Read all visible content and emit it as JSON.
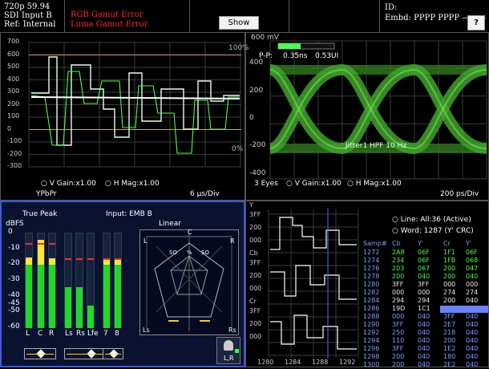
{
  "header": {
    "format": "720p 59.94",
    "input": "SDI Input B",
    "ref": "Ref: Internal",
    "errors": [
      "RGB Gamut Error",
      "Luma Gamut Error"
    ],
    "show_menu": "Show Menu",
    "id_label": "ID:",
    "embd": "Embd: PPPP PPPP ———",
    "help": "?"
  },
  "waveform": {
    "y_ticks": [
      "700",
      "600",
      "500",
      "400",
      "300",
      "200",
      "100",
      "0",
      "-100",
      "-200",
      "-300"
    ],
    "pct_top": "100%",
    "pct_bottom": "0%",
    "v_gain": "V Gain:x1.00",
    "h_mag": "H Mag:x1.00",
    "mode": "YPbPr",
    "timebase": "6 µs/Div"
  },
  "eye": {
    "mv_top": "600 mV",
    "pp_label": "P-P:",
    "pp_time": "0.35ns",
    "pp_ui": "0.53UI",
    "y_ticks": [
      "400",
      "200",
      "0",
      "-200",
      "-400"
    ],
    "jitter": "Jitter1 HPF 10 Hz",
    "eyes": "3 Eyes",
    "v_gain": "V Gain:x1.00",
    "h_mag": "H Mag:x1.00",
    "timebase": "200 ps/Div"
  },
  "audio": {
    "true_peak": "True Peak",
    "input": "Input: EMB B",
    "unit": "dBFS",
    "scale": [
      "0",
      "-10",
      "-20",
      "-30",
      "-40",
      "-45",
      "-50",
      "-60"
    ],
    "channels": [
      "L",
      "C",
      "R",
      "Ls",
      "Rs",
      "Lfe",
      "7",
      "8"
    ],
    "levels_db": [
      -15,
      -4,
      -16,
      -34,
      -34,
      -46,
      -17,
      -17
    ],
    "peak_db": [
      -6,
      -6,
      -6,
      -16,
      -16,
      -16,
      -16,
      -16
    ],
    "surround": {
      "title": "Linear",
      "c": "C",
      "l": "L",
      "r": "R",
      "ls": "Ls",
      "rs": "Rs",
      "so_l": "SO",
      "so_c": "%",
      "so_r": "SO",
      "lr": "L,R"
    }
  },
  "data_view": {
    "axis_labels": [
      "Y",
      "3FF",
      "200",
      "000",
      "Cb",
      "3FF",
      "200",
      "000",
      "Cr",
      "3FF",
      "200",
      "000"
    ],
    "x_ticks": [
      "1280",
      "1284",
      "1288",
      "1292"
    ],
    "line": "Line: All:36 (Active)",
    "word": "Word: 1287 (Y' CRC)",
    "columns": [
      "Samp#",
      "Cb",
      "Y'",
      "Cr",
      "Y'"
    ],
    "rows": [
      [
        "1272",
        "2A8",
        "06F",
        "1F1",
        "06F"
      ],
      [
        "1274",
        "234",
        "06F",
        "1FB",
        "068"
      ],
      [
        "1276",
        "203",
        "067",
        "200",
        "047"
      ],
      [
        "1278",
        "200",
        "040",
        "200",
        "040"
      ],
      [
        "1280",
        "3FF",
        "3FF",
        "000",
        "000"
      ],
      [
        "1282",
        "000",
        "000",
        "274",
        "274"
      ],
      [
        "1284",
        "294",
        "294",
        "200",
        "040"
      ],
      [
        "1286",
        "19D",
        "1C1",
        "",
        ""
      ],
      [
        "1288",
        "000",
        "040",
        "3FF",
        "040"
      ],
      [
        "1290",
        "3FF",
        "040",
        "2E7",
        "040"
      ],
      [
        "1292",
        "250",
        "040",
        "218",
        "040"
      ],
      [
        "1294",
        "110",
        "040",
        "200",
        "040"
      ],
      [
        "1296",
        "3FF",
        "040",
        "1E2",
        "040"
      ],
      [
        "1298",
        "200",
        "040",
        "180",
        "040"
      ],
      [
        "1300",
        "200",
        "040",
        "2E2",
        "040"
      ]
    ]
  },
  "colors": {
    "accent": "#3c5bd8",
    "trace_green": "#4aff4a",
    "error_red": "#ff2a2a",
    "eye_green": "#3fa12a"
  }
}
